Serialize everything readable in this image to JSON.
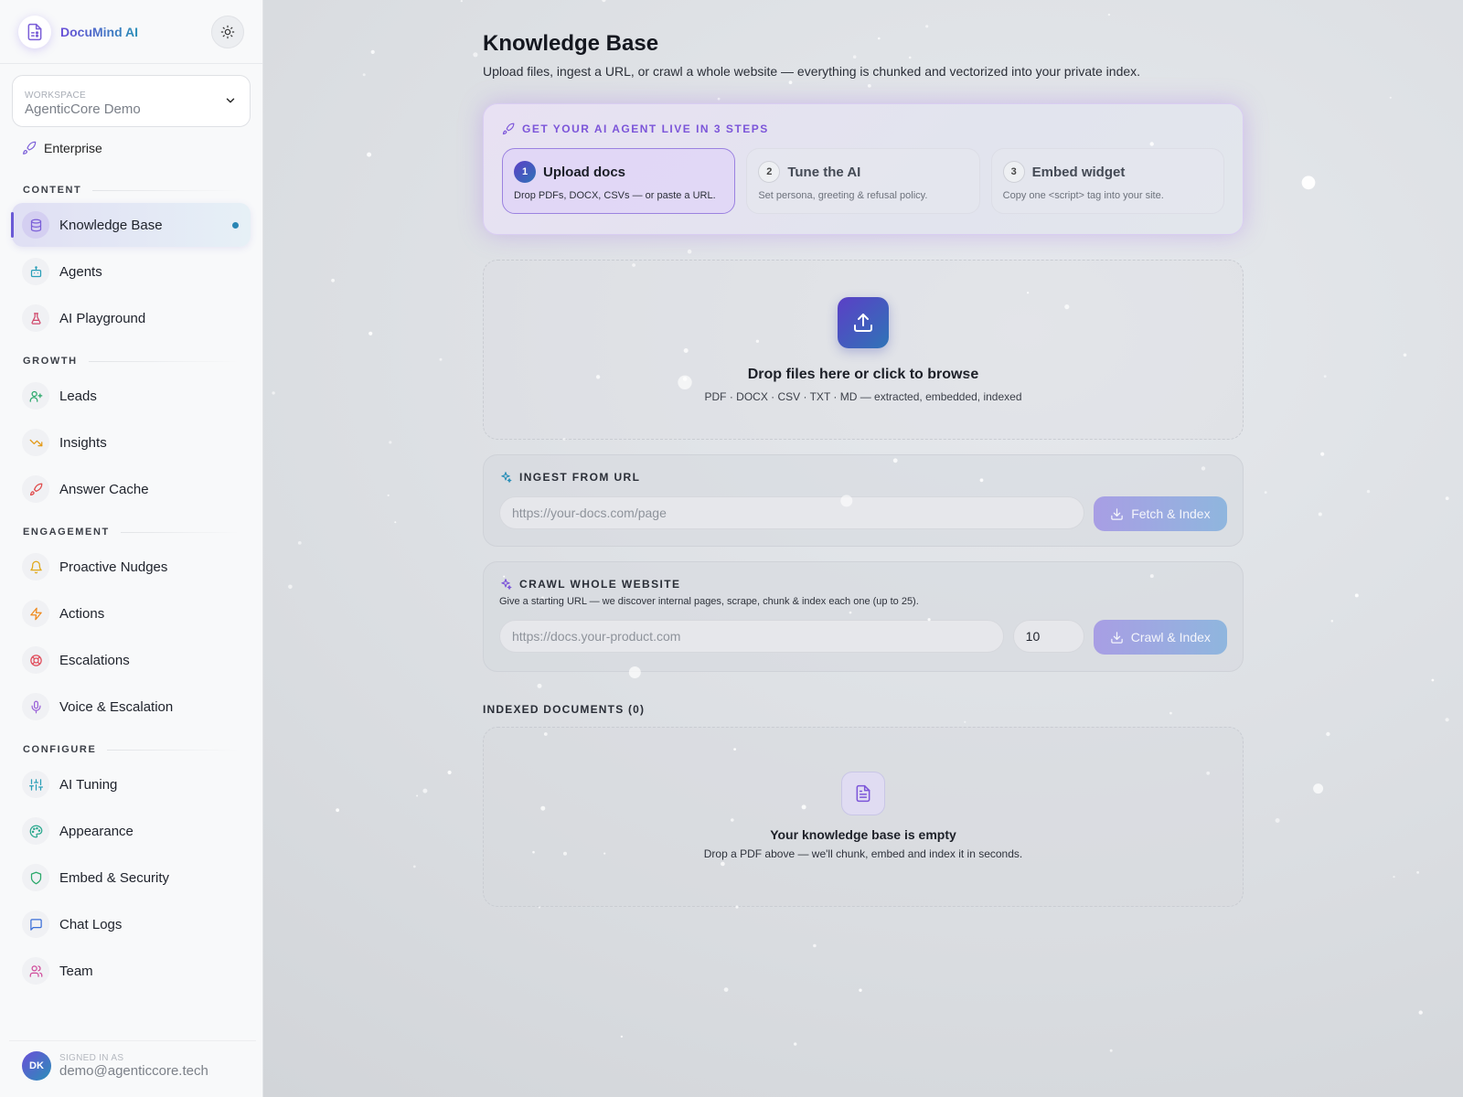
{
  "brand": {
    "name": "DocuMind AI"
  },
  "workspace": {
    "label": "WORKSPACE",
    "value": "AgenticCore Demo"
  },
  "plan": {
    "label": "Enterprise"
  },
  "sidebar": {
    "sections": [
      {
        "label": "CONTENT",
        "items": [
          {
            "label": "Knowledge Base",
            "icon": "database-icon",
            "color": "#7b5fd8",
            "active": true
          },
          {
            "label": "Agents",
            "icon": "bot-icon",
            "color": "#2a9fb8"
          },
          {
            "label": "AI Playground",
            "icon": "flask-icon",
            "color": "#d0476a"
          }
        ]
      },
      {
        "label": "GROWTH",
        "items": [
          {
            "label": "Leads",
            "icon": "user-plus-icon",
            "color": "#2aa86a"
          },
          {
            "label": "Insights",
            "icon": "trending-down-icon",
            "color": "#e39a18"
          },
          {
            "label": "Answer Cache",
            "icon": "rocket-icon",
            "color": "#e04b4b"
          }
        ]
      },
      {
        "label": "ENGAGEMENT",
        "items": [
          {
            "label": "Proactive Nudges",
            "icon": "bell-icon",
            "color": "#e0a818"
          },
          {
            "label": "Actions",
            "icon": "zap-icon",
            "color": "#ef8a1e"
          },
          {
            "label": "Escalations",
            "icon": "life-buoy-icon",
            "color": "#e04b5a"
          },
          {
            "label": "Voice & Escalation",
            "icon": "mic-icon",
            "color": "#9a62d8"
          }
        ]
      },
      {
        "label": "CONFIGURE",
        "items": [
          {
            "label": "AI Tuning",
            "icon": "sliders-icon",
            "color": "#2a9fb8"
          },
          {
            "label": "Appearance",
            "icon": "palette-icon",
            "color": "#2aa88e"
          },
          {
            "label": "Embed & Security",
            "icon": "shield-icon",
            "color": "#2aa86a"
          },
          {
            "label": "Chat Logs",
            "icon": "message-square-icon",
            "color": "#3a6fd8"
          },
          {
            "label": "Team",
            "icon": "users-icon",
            "color": "#d04a9a"
          }
        ]
      }
    ]
  },
  "user": {
    "initials": "DK",
    "label": "SIGNED IN AS",
    "email": "demo@agenticcore.tech"
  },
  "page": {
    "title": "Knowledge Base",
    "subtitle": "Upload files, ingest a URL, or crawl a whole website — everything is chunked and vectorized into your private index."
  },
  "steps": {
    "heading": "GET YOUR AI AGENT LIVE IN 3 STEPS",
    "items": [
      {
        "num": "1",
        "title": "Upload docs",
        "desc": "Drop PDFs, DOCX, CSVs — or paste a URL.",
        "active": true
      },
      {
        "num": "2",
        "title": "Tune the AI",
        "desc": "Set persona, greeting & refusal policy."
      },
      {
        "num": "3",
        "title": "Embed widget",
        "desc": "Copy one <script> tag into your site."
      }
    ]
  },
  "dropzone": {
    "title": "Drop files here or click to browse",
    "subtitle": "PDF · DOCX · CSV · TXT · MD — extracted, embedded, indexed"
  },
  "ingest_url": {
    "heading": "INGEST FROM URL",
    "placeholder": "https://your-docs.com/page",
    "button": "Fetch & Index"
  },
  "crawl": {
    "heading": "CRAWL WHOLE WEBSITE",
    "description": "Give a starting URL — we discover internal pages, scrape, chunk & index each one (up to 25).",
    "placeholder": "https://docs.your-product.com",
    "max_pages": "10",
    "button": "Crawl & Index"
  },
  "documents": {
    "label": "INDEXED DOCUMENTS (0)",
    "empty_title": "Your knowledge base is empty",
    "empty_sub": "Drop a PDF above — we'll chunk, embed and index it in seconds."
  }
}
